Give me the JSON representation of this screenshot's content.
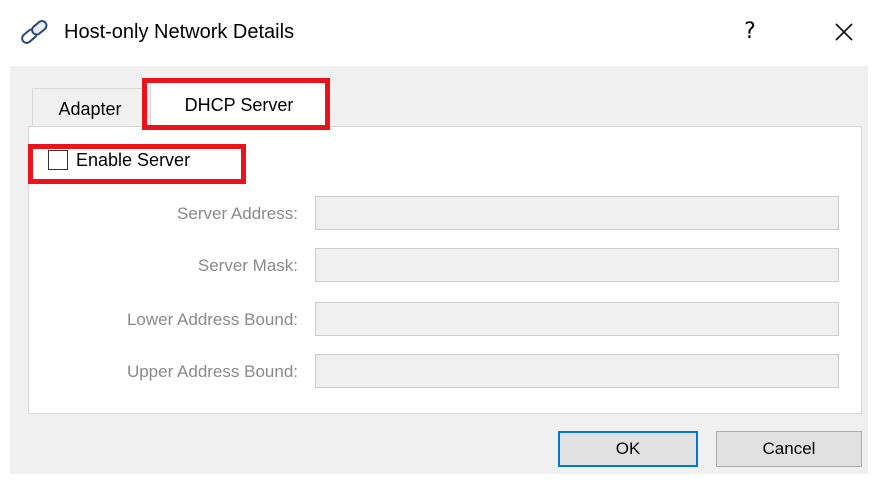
{
  "window": {
    "title": "Host-only Network Details",
    "icon": "network-link-icon",
    "help_label": "?",
    "close_icon": "close-icon"
  },
  "tabs": [
    {
      "label": "Adapter",
      "selected": false
    },
    {
      "label": "DHCP Server",
      "selected": true
    }
  ],
  "dhcp": {
    "enable_label": "Enable Server",
    "enable_checked": false,
    "fields": [
      {
        "label": "Server Address:",
        "value": ""
      },
      {
        "label": "Server Mask:",
        "value": ""
      },
      {
        "label": "Lower Address Bound:",
        "value": ""
      },
      {
        "label": "Upper Address Bound:",
        "value": ""
      }
    ]
  },
  "buttons": {
    "ok": "OK",
    "cancel": "Cancel"
  },
  "colors": {
    "highlight": "#e8131b",
    "default_button_border": "#0078d7",
    "disabled_text": "#8a8a8a"
  }
}
